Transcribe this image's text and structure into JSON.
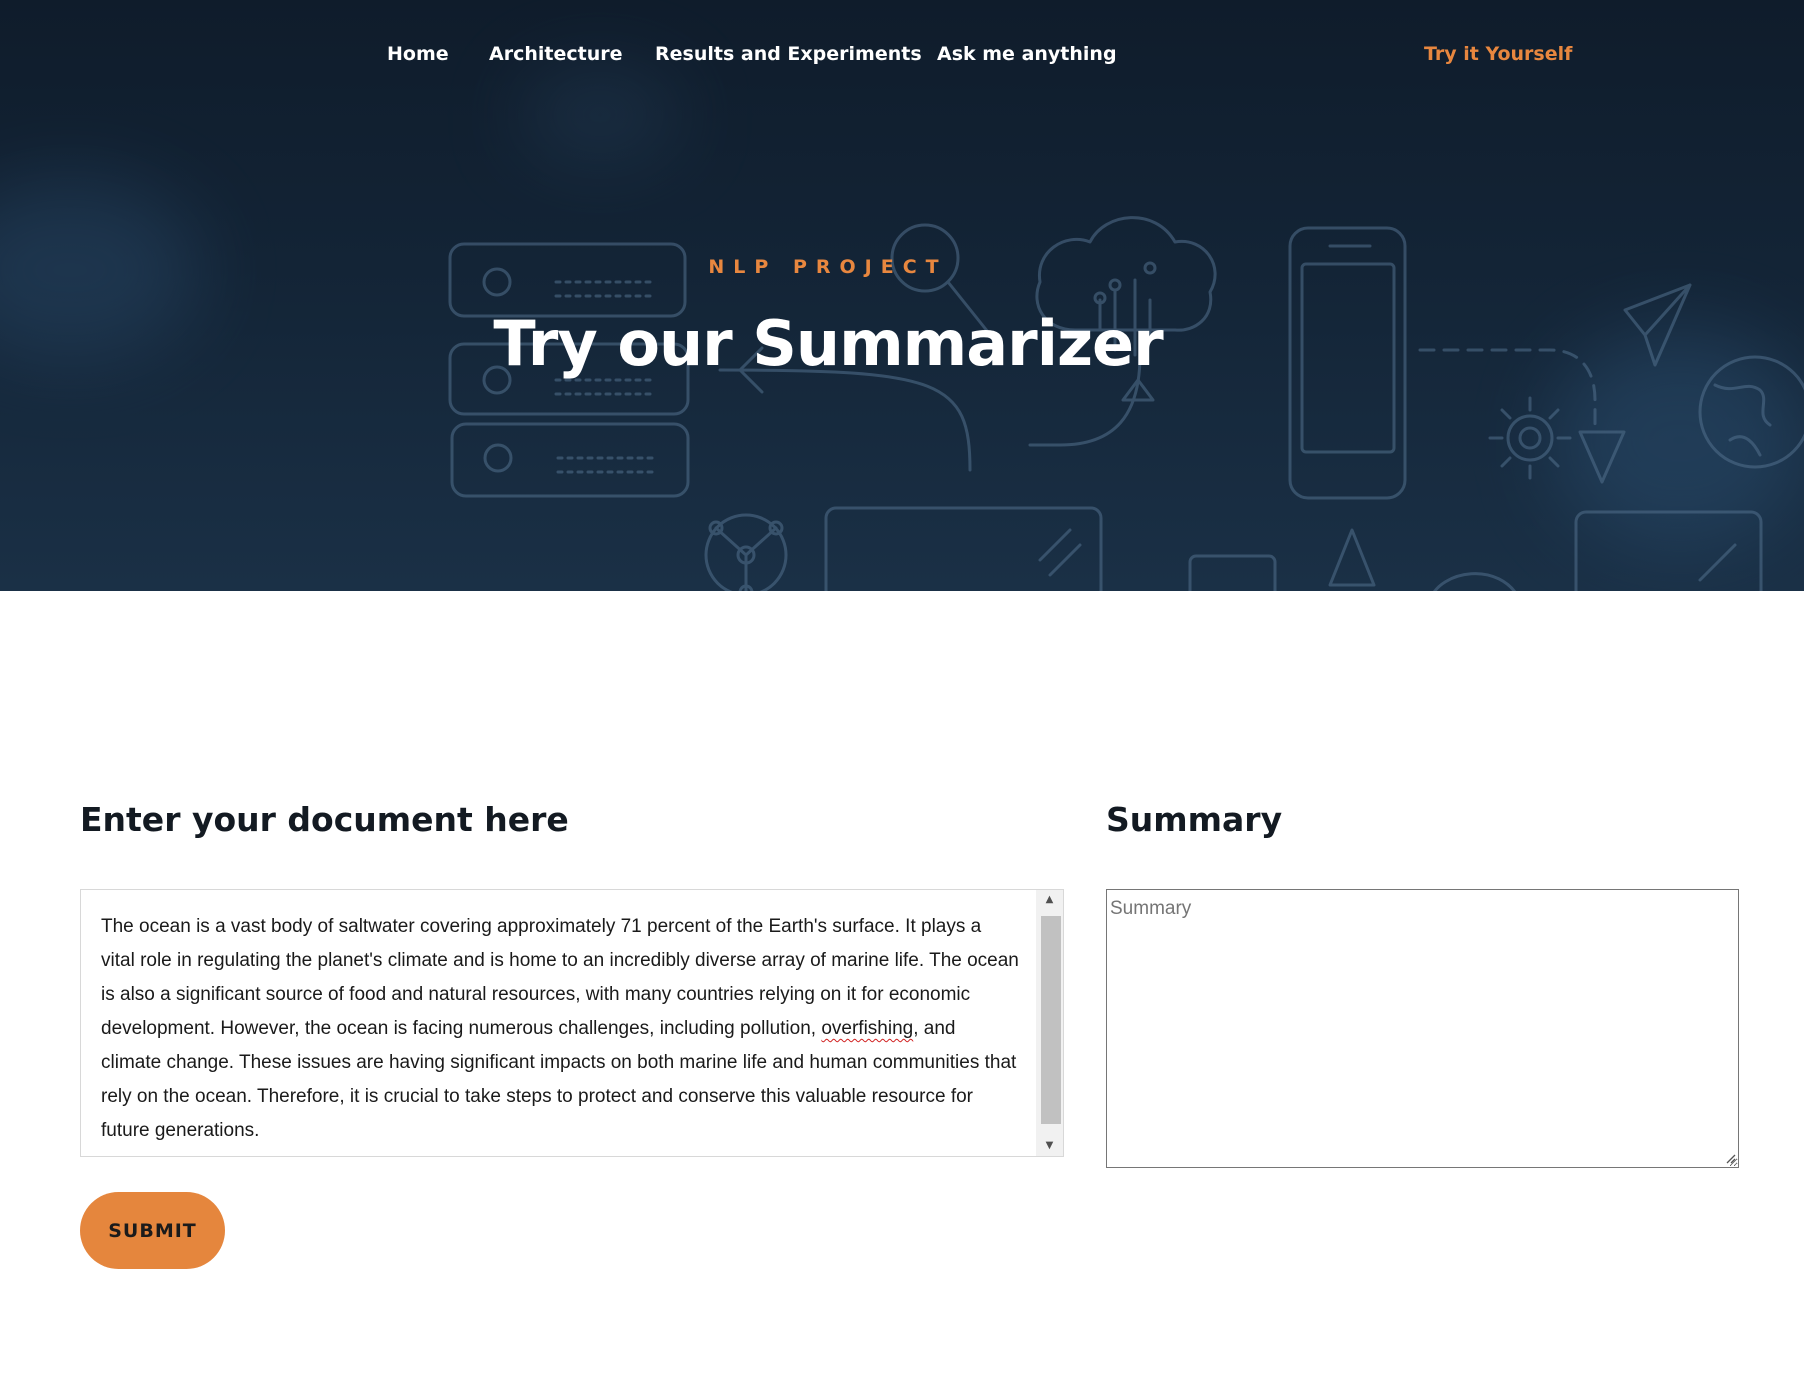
{
  "nav": {
    "items": [
      "Home",
      "Architecture",
      "Results and Experiments",
      "Ask me anything"
    ],
    "cta": "Try it Yourself"
  },
  "hero": {
    "eyebrow": "NLP PROJECT",
    "title": "Try our Summarizer"
  },
  "form": {
    "document_heading": "Enter your document here",
    "document_text_parts": {
      "before": "The ocean is a vast body of saltwater covering approximately 71 percent of the Earth's surface. It plays a vital role in regulating the planet's climate and is home to an incredibly diverse array of marine life. The ocean is also a significant source of food and natural resources, with many countries relying on it for economic development. However, the ocean is facing numerous challenges, including pollution, ",
      "misspelled": "overfishing",
      "after": ", and climate change. These issues are having significant impacts on both marine life and human communities that rely on the ocean. Therefore, it is crucial to take steps to protect and conserve this valuable resource for future generations."
    },
    "submit_label": "SUBMIT",
    "summary_heading": "Summary",
    "summary_placeholder": "Summary",
    "summary_value": ""
  },
  "colors": {
    "accent": "#e8873f",
    "hero_bg": "#132436",
    "heading": "#131a22"
  },
  "icons": [
    "server-icon",
    "cloud-network-icon",
    "magnifier-icon",
    "smartphone-icon",
    "paper-plane-icon",
    "gear-icon",
    "globe-icon",
    "network-node-icon",
    "monitor-icon",
    "triangle-icon"
  ]
}
